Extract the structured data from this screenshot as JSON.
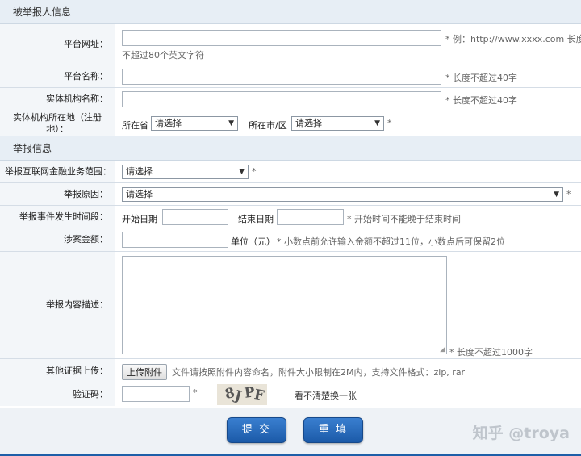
{
  "sections": {
    "reported": "被举报人信息",
    "report": "举报信息"
  },
  "fields": {
    "url_label": "平台网址：",
    "url_hint": "* 例：http://www.xxxx.com 长度",
    "url_hint2": "不超过80个英文字符",
    "name_label": "平台名称：",
    "name_hint": "* 长度不超过40字",
    "entity_label": "实体机构名称：",
    "entity_hint": "* 长度不超过40字",
    "location_label": "实体机构所在地（注册地）：",
    "province_text": "所在省",
    "province_select": "请选择",
    "city_text": "所在市/区",
    "city_select": "请选择",
    "star": "*",
    "scope_label": "举报互联网金融业务范围：",
    "scope_select": "请选择",
    "reason_label": "举报原因：",
    "reason_select": "请选择",
    "period_label": "举报事件发生时间段：",
    "start_text": "开始日期",
    "end_text": "结束日期",
    "period_hint": "* 开始时间不能晚于结束时间",
    "amount_label": "涉案金额：",
    "amount_unit": "单位（元）",
    "amount_hint": "* 小数点前允许输入金额不超过11位，小数点后可保留2位",
    "desc_label": "举报内容描述：",
    "desc_hint": "* 长度不超过1000字",
    "upload_label": "其他证据上传：",
    "upload_button": "上传附件",
    "upload_hint": "文件请按照附件内容命名，附件大小限制在2M内，支持文件格式：zip, rar",
    "captcha_label": "验证码：",
    "captcha_chars": [
      "8",
      "J",
      "P",
      "F"
    ],
    "captcha_refresh": "看不清楚换一张"
  },
  "buttons": {
    "submit": "提 交",
    "reset": "重 填"
  },
  "watermark": "知乎 @troya",
  "colors": {
    "accent": "#1d5fa8",
    "section_bg": "#e7eef5"
  }
}
